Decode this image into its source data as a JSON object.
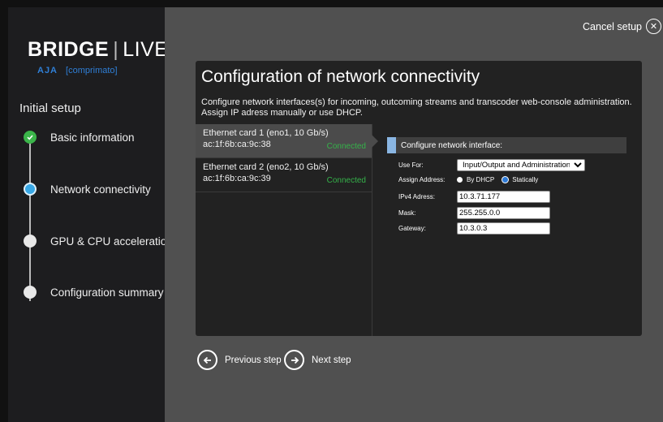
{
  "cancel": {
    "label": "Cancel setup",
    "icon": "close-circle-icon"
  },
  "logo": {
    "bridge": "BRIDGE",
    "separator": "|",
    "live": "LIVE",
    "aja": "AJA",
    "comprimato": "[comprimato]"
  },
  "sidebar": {
    "title": "Initial setup",
    "steps": [
      {
        "label": "Basic information",
        "state": "done"
      },
      {
        "label": "Network connectivity",
        "state": "active"
      },
      {
        "label": "GPU & CPU acceleration",
        "state": "pending"
      },
      {
        "label": "Configuration summary",
        "state": "pending"
      }
    ]
  },
  "main": {
    "title": "Configuration of network connectivity",
    "description": "Configure network interfaces(s) for incoming, outcoming streams and transcoder web-console administration. Assign IP adress manually or use DHCP.",
    "interfaces": [
      {
        "name": "Ethernet card 1 (eno1, 10 Gb/s)",
        "mac": "ac:1f:6b:ca:9c:38",
        "status": "Connected",
        "selected": true
      },
      {
        "name": "Ethernet card 2 (eno2, 10 Gb/s)",
        "mac": "ac:1f:6b:ca:9c:39",
        "status": "Connected",
        "selected": false
      }
    ],
    "config": {
      "header": "Configure network interface:",
      "use_for_label": "Use For:",
      "use_for_value": "Input/Output and Administration",
      "assign_label": "Assign Address:",
      "dhcp_label": "By DHCP",
      "static_label": "Statically",
      "assign_selected": "Statically",
      "ipv4_label": "IPv4 Adress:",
      "ipv4_value": "10.3.71.177",
      "mask_label": "Mask:",
      "mask_value": "255.255.0.0",
      "gateway_label": "Gateway:",
      "gateway_value": "10.3.0.3"
    }
  },
  "nav": {
    "prev_label": "Previous step",
    "next_label": "Next step"
  },
  "colors": {
    "accent": "#38a8e6",
    "connected": "#35b24a",
    "done": "#3bb54a"
  }
}
